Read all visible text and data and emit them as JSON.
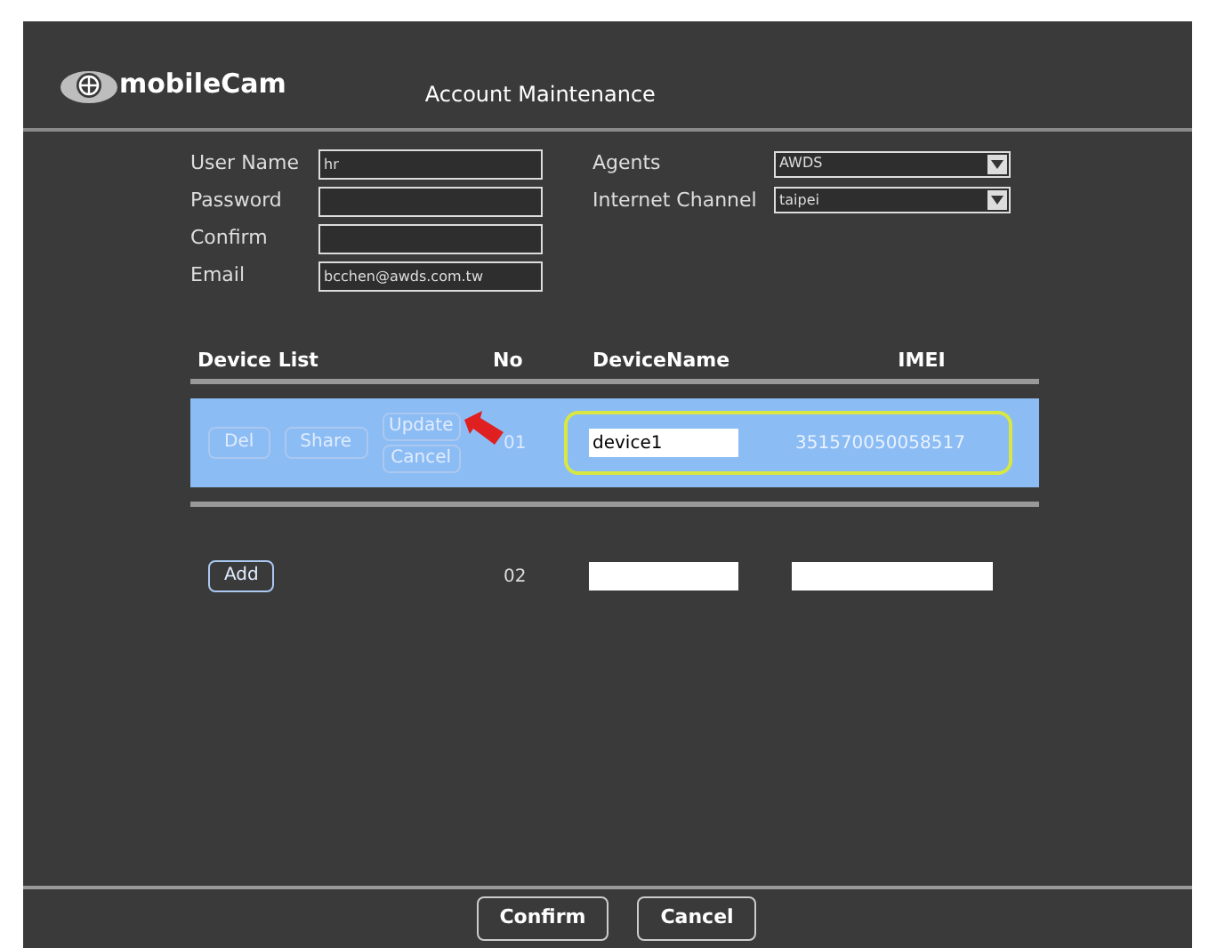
{
  "header": {
    "logo": "mobileCam",
    "title": "Account Maintenance"
  },
  "form": {
    "left": [
      {
        "label": "User Name",
        "value": "hr"
      },
      {
        "label": "Password"
      },
      {
        "label": "Confirm"
      },
      {
        "label": "Email",
        "value": "bcchen@awds.com.tw"
      }
    ],
    "right": [
      {
        "label": "Agents",
        "value": "AWDS"
      },
      {
        "label": "Internet Channel",
        "value": "taipei"
      }
    ]
  },
  "device_list": {
    "columns": [
      "Device List",
      "No",
      "DeviceName",
      "IMEI"
    ],
    "rows": [
      {
        "selected": true,
        "actions": [
          "Del",
          "Share"
        ],
        "edit_actions": [
          "Update",
          "Cancel"
        ],
        "no": "01",
        "device_name": "device1",
        "imei": "351570050058517"
      },
      {
        "selected": false,
        "actions": [
          "Add"
        ],
        "edit_actions": [],
        "no": "02"
      }
    ]
  },
  "buttons": [
    "Confirm",
    "Cancel"
  ]
}
